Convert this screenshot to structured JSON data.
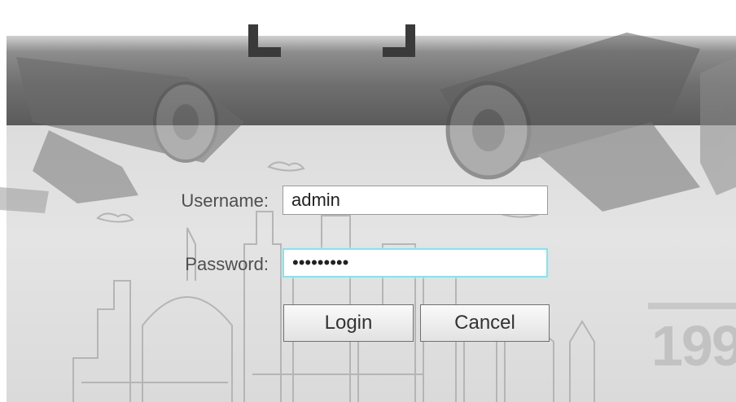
{
  "login": {
    "username_label": "Username:",
    "username_value": "admin",
    "password_label": "Password:",
    "password_value": "123456789",
    "login_label": "Login",
    "cancel_label": "Cancel"
  },
  "background": {
    "brand_text": "199"
  },
  "colors": {
    "header_band": "#6f6f6f",
    "panel_bg": "#dcdcdc",
    "field_focus": "#8ee0e8"
  }
}
